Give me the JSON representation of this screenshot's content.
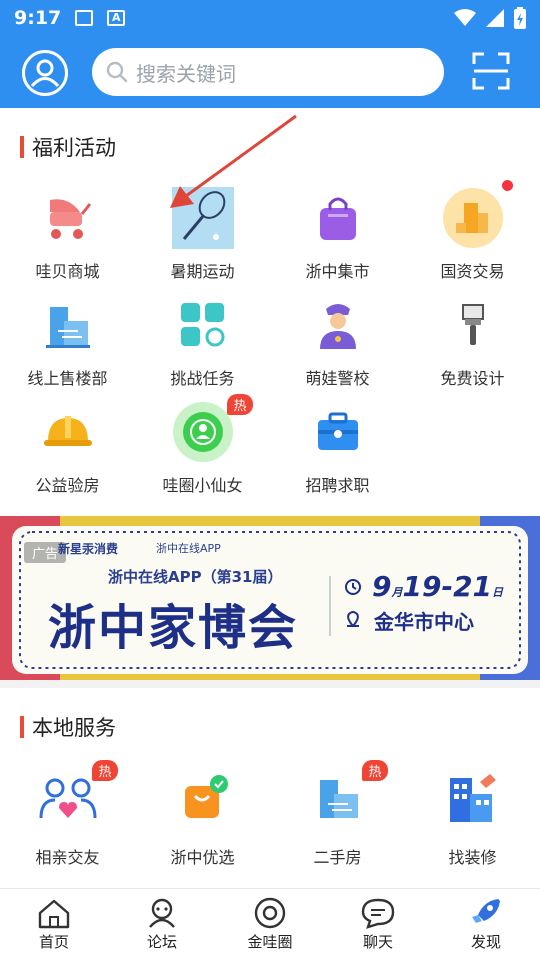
{
  "status": {
    "time": "9:17"
  },
  "search": {
    "placeholder": "搜索关键词"
  },
  "welfare": {
    "title": "福利活动",
    "items": [
      {
        "label": "哇贝商城",
        "icon": "baby-stroller-icon"
      },
      {
        "label": "暑期运动",
        "icon": "badminton-icon"
      },
      {
        "label": "浙中集市",
        "icon": "shopping-bag-icon"
      },
      {
        "label": "国资交易",
        "icon": "building-coin-icon",
        "dot": true
      },
      {
        "label": "线上售楼部",
        "icon": "sales-building-icon"
      },
      {
        "label": "挑战任务",
        "icon": "tiles-icon"
      },
      {
        "label": "萌娃警校",
        "icon": "police-icon"
      },
      {
        "label": "免费设计",
        "icon": "paint-brush-icon"
      },
      {
        "label": "公益验房",
        "icon": "hard-hat-icon"
      },
      {
        "label": "哇圈小仙女",
        "icon": "target-person-icon",
        "badge": "热"
      },
      {
        "label": "招聘求职",
        "icon": "briefcase-icon"
      }
    ]
  },
  "banner": {
    "ad_tag": "广告",
    "sponsor1": "新星汞消费",
    "sponsor2": "浙中在线APP",
    "subtitle": "浙中在线APP（第31届）",
    "title": "浙中家博会",
    "date_month": "9",
    "date_month_unit": "月",
    "date_days": "19-21",
    "date_day_unit": "日",
    "venue": "金华市中心"
  },
  "local": {
    "title": "本地服务",
    "items": [
      {
        "label": "相亲交友",
        "icon": "people-heart-icon",
        "badge": "热"
      },
      {
        "label": "浙中优选",
        "icon": "orange-bag-icon"
      },
      {
        "label": "二手房",
        "icon": "secondhand-house-icon",
        "badge": "热"
      },
      {
        "label": "找装修",
        "icon": "decoration-building-icon"
      }
    ]
  },
  "tabs": [
    {
      "label": "首页",
      "icon": "home-icon"
    },
    {
      "label": "论坛",
      "icon": "forum-icon"
    },
    {
      "label": "金哇圈",
      "icon": "circle-icon"
    },
    {
      "label": "聊天",
      "icon": "chat-icon"
    },
    {
      "label": "发现",
      "icon": "rocket-icon"
    }
  ],
  "colors": {
    "brand": "#2f8ff0",
    "accent": "#e94b35"
  }
}
